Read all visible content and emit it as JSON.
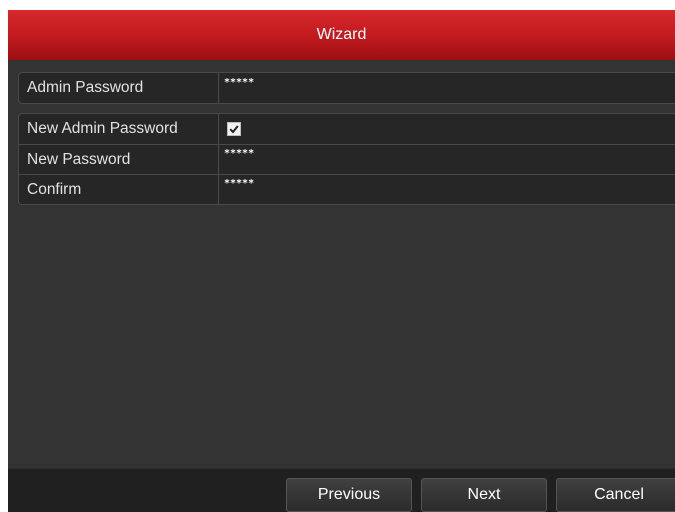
{
  "window": {
    "title": "Wizard"
  },
  "admin_group": {
    "admin_password": {
      "label": "Admin Password",
      "value": "*****"
    }
  },
  "new_group": {
    "new_admin_password": {
      "label": "New Admin Password",
      "checked": true
    },
    "new_password": {
      "label": "New Password",
      "value": "*****"
    },
    "confirm": {
      "label": "Confirm",
      "value": "*****"
    }
  },
  "footer": {
    "previous_label": "Previous",
    "next_label": "Next",
    "cancel_label": "Cancel"
  },
  "colors": {
    "title_bar": "#c01a1e",
    "panel_bg": "#333333",
    "field_bg": "#262626",
    "text": "#ffffff"
  },
  "icons": {
    "checkbox": "check-icon"
  }
}
